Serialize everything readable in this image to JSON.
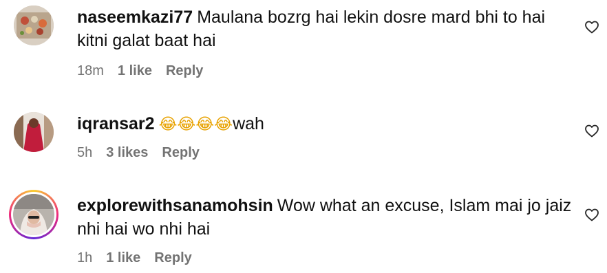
{
  "comments": [
    {
      "username": "naseemkazi77",
      "text": "Maulana bozrg hai lekin dosre mard bhi to hai kitni galat baat hai",
      "time": "18m",
      "likes": "1 like",
      "reply": "Reply"
    },
    {
      "username": "iqransar2",
      "emojis": "😂😂😂😂",
      "text": "wah",
      "time": "5h",
      "likes": "3 likes",
      "reply": "Reply"
    },
    {
      "username": "explorewithsanamohsin",
      "text": "Wow what an excuse, Islam mai jo jaiz nhi hai wo nhi hai",
      "time": "1h",
      "likes": "1 like",
      "reply": "Reply"
    }
  ],
  "icons": {
    "like": "heart-outline-icon"
  },
  "colors": {
    "meta_text": "#737373",
    "story_ring": [
      "#f9ce34",
      "#ee2a7b",
      "#6228d7"
    ]
  }
}
